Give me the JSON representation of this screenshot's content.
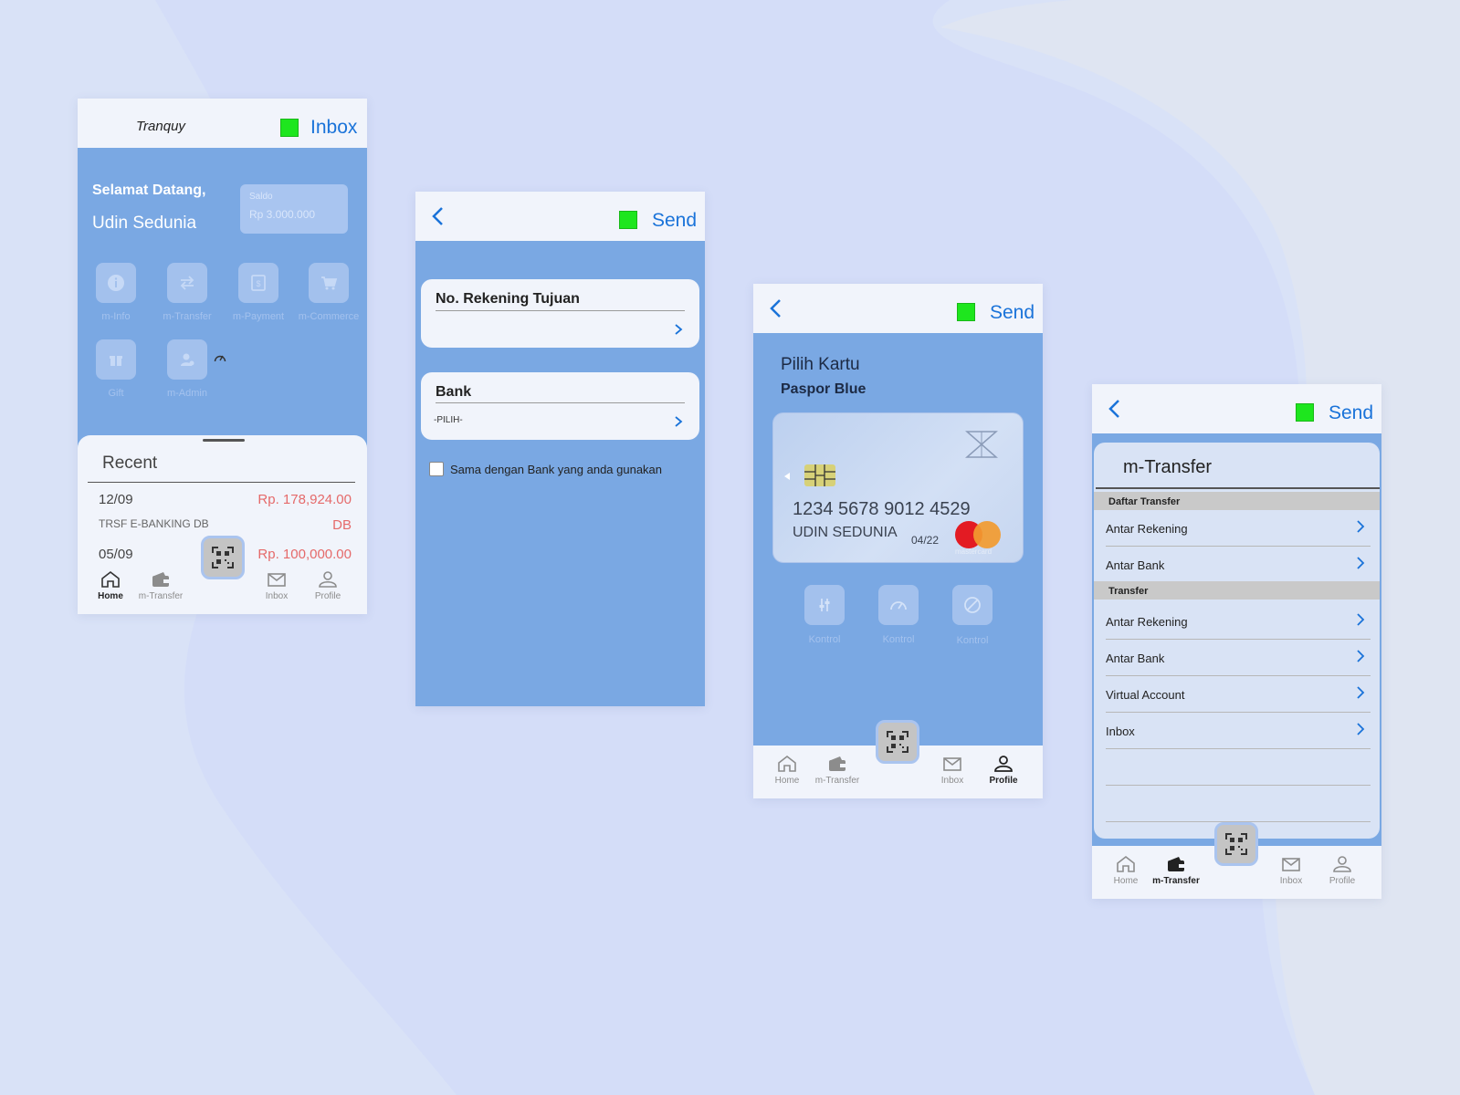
{
  "colors": {
    "accent": "#1a73d9",
    "status_green": "#1ee61e",
    "panel_blue": "#7aa8e3",
    "amount_red": "#e56a6a"
  },
  "screen1": {
    "title": "Tranquy",
    "action": "Inbox",
    "greeting": "Selamat Datang,",
    "username": "Udin Sedunia",
    "saldo_label": "Saldo",
    "saldo_value": "Rp 3.000.000",
    "menu": [
      {
        "label": "m-Info",
        "icon": "info-icon"
      },
      {
        "label": "m-Transfer",
        "icon": "transfer-icon"
      },
      {
        "label": "m-Payment",
        "icon": "payment-icon"
      },
      {
        "label": "m-Commerce",
        "icon": "cart-icon"
      },
      {
        "label": "Gift",
        "icon": "gift-icon"
      },
      {
        "label": "m-Admin",
        "icon": "admin-icon"
      }
    ],
    "recent_title": "Recent",
    "transactions": [
      {
        "date": "12/09",
        "amount": "Rp. 178,924.00",
        "desc": "TRSF E-BANKING DB",
        "type": "DB"
      },
      {
        "date": "05/09",
        "amount": "Rp. 100,000.00"
      }
    ],
    "nav": [
      "Home",
      "m-Transfer",
      "Inbox",
      "Profile"
    ]
  },
  "screen2": {
    "action": "Send",
    "field1_label": "No. Rekening Tujuan",
    "field2_label": "Bank",
    "field2_value": "-PILIH-",
    "checkbox_label": "Sama dengan Bank yang anda gunakan"
  },
  "screen3": {
    "action": "Send",
    "title": "Pilih Kartu",
    "subtitle": "Paspor Blue",
    "card_number": "1234 5678 9012 4529",
    "card_holder": "UDIN SEDUNIA",
    "card_expiry": "04/22",
    "card_brand": "mastercard",
    "controls": [
      "Kontrol",
      "Kontrol",
      "Kontrol"
    ],
    "nav": [
      "Home",
      "m-Transfer",
      "Inbox",
      "Profile"
    ]
  },
  "screen4": {
    "action": "Send",
    "title": "m-Transfer",
    "section1": "Daftar Transfer",
    "section1_items": [
      "Antar Rekening",
      "Antar Bank"
    ],
    "section2": "Transfer",
    "section2_items": [
      "Antar Rekening",
      "Antar Bank",
      "Virtual Account",
      "Inbox"
    ],
    "nav": [
      "Home",
      "m-Transfer",
      "Inbox",
      "Profile"
    ]
  }
}
